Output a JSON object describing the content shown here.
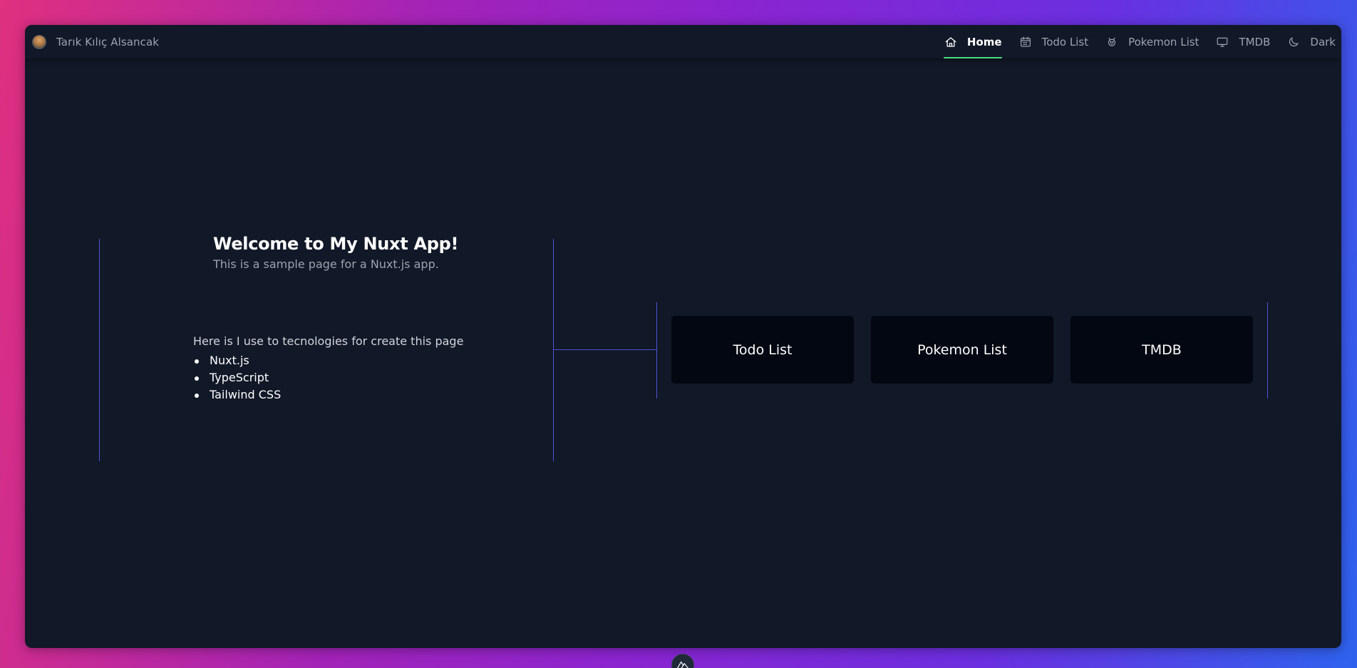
{
  "header": {
    "brand_name": "Tarık Kılıç Alsancak",
    "nav": [
      {
        "label": "Home",
        "icon": "home-icon",
        "active": true
      },
      {
        "label": "Todo List",
        "icon": "calendar-icon",
        "active": false
      },
      {
        "label": "Pokemon List",
        "icon": "pokemon-icon",
        "active": false
      },
      {
        "label": "TMDB",
        "icon": "monitor-icon",
        "active": false
      },
      {
        "label": "Dark",
        "icon": "moon-icon",
        "active": false
      }
    ]
  },
  "hero": {
    "title": "Welcome to My Nuxt App!",
    "subtitle": "This is a sample page for a Nuxt.js app."
  },
  "tech": {
    "intro": "Here is I use to tecnologies for create this page",
    "items": [
      "Nuxt.js",
      "TypeScript",
      "Tailwind CSS"
    ]
  },
  "cards": [
    {
      "label": "Todo List"
    },
    {
      "label": "Pokemon List"
    },
    {
      "label": "TMDB"
    }
  ],
  "colors": {
    "accent_line": "#4f52d6",
    "active_underline": "#4ade80",
    "window_bg": "#111827",
    "card_bg": "#030712"
  },
  "devtools": {
    "icon": "nuxt-devtools-icon"
  }
}
